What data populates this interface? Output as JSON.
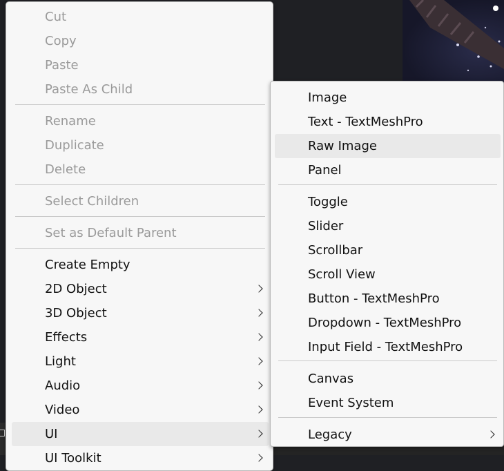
{
  "main_menu": {
    "items": [
      {
        "label": "Cut",
        "enabled": false
      },
      {
        "label": "Copy",
        "enabled": false
      },
      {
        "label": "Paste",
        "enabled": false
      },
      {
        "label": "Paste As Child",
        "enabled": false
      },
      {
        "label": "Rename",
        "enabled": false
      },
      {
        "label": "Duplicate",
        "enabled": false
      },
      {
        "label": "Delete",
        "enabled": false
      },
      {
        "label": "Select Children",
        "enabled": false
      },
      {
        "label": "Set as Default Parent",
        "enabled": false
      },
      {
        "label": "Create Empty",
        "enabled": true
      },
      {
        "label": "2D Object",
        "enabled": true,
        "submenu": true
      },
      {
        "label": "3D Object",
        "enabled": true,
        "submenu": true
      },
      {
        "label": "Effects",
        "enabled": true,
        "submenu": true
      },
      {
        "label": "Light",
        "enabled": true,
        "submenu": true
      },
      {
        "label": "Audio",
        "enabled": true,
        "submenu": true
      },
      {
        "label": "Video",
        "enabled": true,
        "submenu": true
      },
      {
        "label": "UI",
        "enabled": true,
        "submenu": true,
        "highlighted": true
      },
      {
        "label": "UI Toolkit",
        "enabled": true,
        "submenu": true
      }
    ]
  },
  "ui_submenu": {
    "items": [
      {
        "label": "Image"
      },
      {
        "label": "Text - TextMeshPro"
      },
      {
        "label": "Raw Image",
        "hovered": true
      },
      {
        "label": "Panel"
      },
      {
        "label": "Toggle"
      },
      {
        "label": "Slider"
      },
      {
        "label": "Scrollbar"
      },
      {
        "label": "Scroll View"
      },
      {
        "label": "Button - TextMeshPro"
      },
      {
        "label": "Dropdown - TextMeshPro"
      },
      {
        "label": "Input Field - TextMeshPro"
      },
      {
        "label": "Canvas"
      },
      {
        "label": "Event System"
      },
      {
        "label": "Legacy",
        "submenu": true
      }
    ]
  },
  "icons": {
    "submenu_arrow": "chevron-right-icon"
  },
  "colors": {
    "menu_background": "#f7f7f7",
    "disabled_text": "#9a9a9a",
    "enabled_text": "#111111",
    "highlight": "#e9e9e9",
    "separator": "#c9c9c9"
  }
}
